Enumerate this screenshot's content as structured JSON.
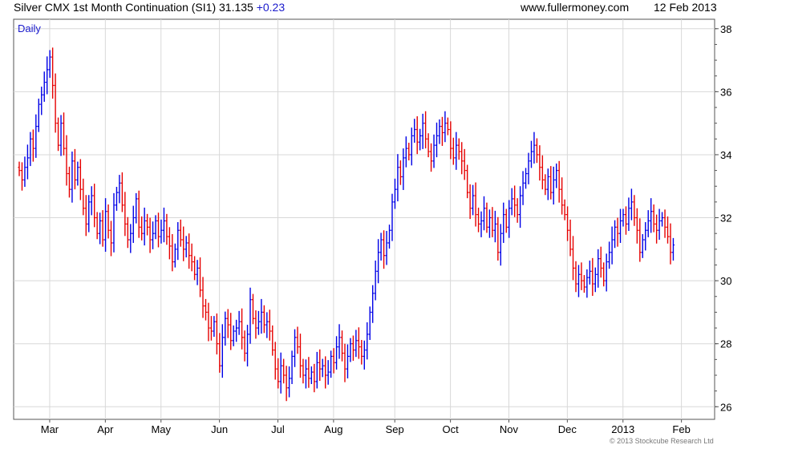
{
  "header": {
    "title": "Silver CMX 1st Month Continuation (SI1) 31.135",
    "change": "+0.23",
    "source": "www.fullermoney.com",
    "date": "12 Feb 2013"
  },
  "footer": {
    "copyright": "© 2013 Stockcube Research Ltd"
  },
  "colors": {
    "up": "#0000e6",
    "down": "#e60000",
    "grid": "#d8d8d8",
    "frame": "#555555"
  },
  "chart_data": {
    "type": "ohlc",
    "period_label": "Daily",
    "ylim": [
      25.6,
      38.3
    ],
    "y_ticks": [
      26,
      28,
      30,
      32,
      34,
      36,
      38
    ],
    "x_ticks": [
      "Mar",
      "Apr",
      "May",
      "Jun",
      "Jul",
      "Aug",
      "Sep",
      "Oct",
      "Nov",
      "Dec",
      "2013",
      "Feb"
    ],
    "x_tick_positions": [
      2,
      22,
      42,
      63,
      84,
      104,
      126,
      146,
      167,
      188,
      208,
      229
    ],
    "grid": true,
    "y_axis_side": "right",
    "series": [
      {
        "closes": [
          33.5,
          33.2,
          33.6,
          33.9,
          34.5,
          34.2,
          34.9,
          35.6,
          35.9,
          36.3,
          36.7,
          37.1,
          36.2,
          35.0,
          34.3,
          35.0,
          34.2,
          33.4,
          32.9,
          33.8,
          33.2,
          33.6,
          32.9,
          32.3,
          31.8,
          32.5,
          32.7,
          32.0,
          31.5,
          31.9,
          31.3,
          32.2,
          31.6,
          31.2,
          32.4,
          32.8,
          33.1,
          32.4,
          31.8,
          31.3,
          31.5,
          32.0,
          32.6,
          31.7,
          31.5,
          31.9,
          31.7,
          31.3,
          31.5,
          31.9,
          31.4,
          31.6,
          31.9,
          31.4,
          31.1,
          30.6,
          31.0,
          31.6,
          31.3,
          31.0,
          31.2,
          30.8,
          30.6,
          30.2,
          30.4,
          29.7,
          29.2,
          29.0,
          28.5,
          28.4,
          28.7,
          28.0,
          27.3,
          28.2,
          28.8,
          28.6,
          28.1,
          28.4,
          28.5,
          28.7,
          28.2,
          27.7,
          28.3,
          29.4,
          28.8,
          28.5,
          28.7,
          29.0,
          28.6,
          28.7,
          28.4,
          27.8,
          27.2,
          26.8,
          27.3,
          27.0,
          26.6,
          26.9,
          27.6,
          28.2,
          27.9,
          27.3,
          27.0,
          27.2,
          26.9,
          27.1,
          26.8,
          27.4,
          27.2,
          27.3,
          27.0,
          27.1,
          27.6,
          27.4,
          27.9,
          28.2,
          27.7,
          27.2,
          27.6,
          28.0,
          27.8,
          28.1,
          27.9,
          27.6,
          27.8,
          28.3,
          29.0,
          29.6,
          30.3,
          30.9,
          31.3,
          30.8,
          31.2,
          31.6,
          32.5,
          32.9,
          33.6,
          33.3,
          33.9,
          34.2,
          34.0,
          34.6,
          34.8,
          34.4,
          34.6,
          35.0,
          34.5,
          34.1,
          33.8,
          34.3,
          34.6,
          34.9,
          34.7,
          35.0,
          34.8,
          34.2,
          33.9,
          34.3,
          34.1,
          33.8,
          33.5,
          32.8,
          32.3,
          32.7,
          32.1,
          31.8,
          31.9,
          32.3,
          31.7,
          32.0,
          31.6,
          31.8,
          30.9,
          31.5,
          32.1,
          31.7,
          32.3,
          32.6,
          32.4,
          32.1,
          32.7,
          33.1,
          33.4,
          33.8,
          34.1,
          34.3,
          34.0,
          33.6,
          33.2,
          32.9,
          33.3,
          32.8,
          33.2,
          33.5,
          32.9,
          32.4,
          32.1,
          31.6,
          31.0,
          30.4,
          29.9,
          30.2,
          30.0,
          29.8,
          30.1,
          30.3,
          29.9,
          30.2,
          30.7,
          30.4,
          30.0,
          30.6,
          30.9,
          31.3,
          31.7,
          31.5,
          31.9,
          32.1,
          31.8,
          32.3,
          32.5,
          32.0,
          31.6,
          30.9,
          31.3,
          31.6,
          31.9,
          32.2,
          31.8,
          31.6,
          31.9,
          32.0,
          31.7,
          31.4,
          30.9,
          31.135
        ],
        "up_color": "#0000e6",
        "down_color": "#e60000"
      }
    ]
  }
}
